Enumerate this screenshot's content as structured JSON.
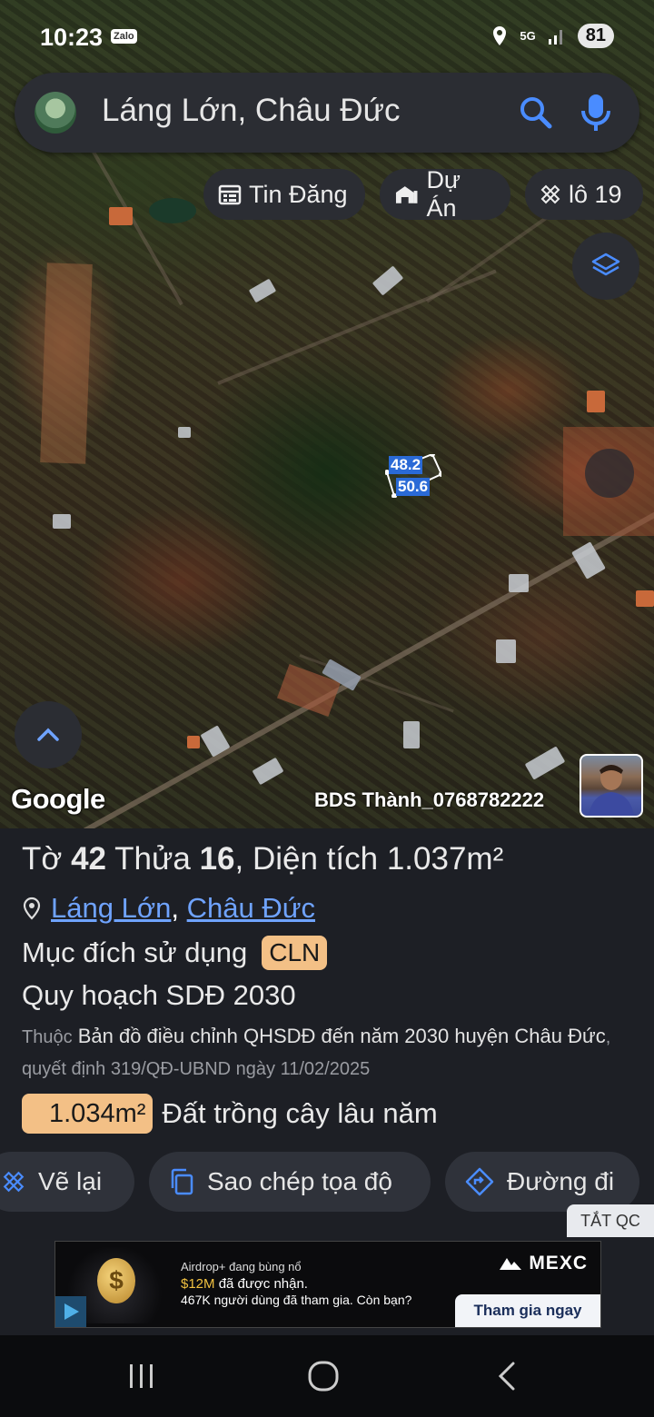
{
  "status_bar": {
    "time": "10:23",
    "app_badge": "Zalo",
    "network": "5G",
    "battery": "81"
  },
  "search": {
    "query": "Láng Lớn, Châu Đức"
  },
  "chips": {
    "listings": "Tin Đăng",
    "projects": "Dự Án",
    "lot": "lô 19"
  },
  "map": {
    "parcel_edge_1": "48.2",
    "parcel_edge_2": "50.6",
    "attribution": "Google",
    "watermark": "BDS Thành_0768782222"
  },
  "parcel": {
    "title_sheet_label": "Tờ",
    "sheet": "42",
    "title_plot_label": "Thửa",
    "plot": "16",
    "title_area_label": ", Diện tích",
    "area": "1.037m²",
    "commune": "Láng Lớn",
    "separator": ",",
    "district": "Châu Đức",
    "purpose_label": "Mục đích sử dụng",
    "purpose_code": "CLN",
    "plan_title": "Quy hoạch SDĐ 2030",
    "desc_prefix": "Thuộc",
    "desc_map": "Bản đồ điều chỉnh QHSDĐ đến năm 2030 huyện Châu Đức",
    "desc_decision": ", quyết định 319/QĐ-UBND ngày 11/02/2025",
    "landuse_area": "1.034m²",
    "landuse_type": "Đất trồng cây lâu năm"
  },
  "actions": {
    "redraw": "Vẽ lại",
    "copy_coords": "Sao chép tọa độ",
    "directions": "Đường đi",
    "hide_ads": "TẮT QC"
  },
  "ad": {
    "line1": "Airdrop+ đang bùng nổ",
    "line2_amount": "$12M",
    "line2_rest": " đã được nhận.",
    "line3": "467K người dùng đã tham gia. Còn bạn?",
    "brand": "MEXC",
    "cta": "Tham gia ngay",
    "coin_symbol": "$"
  },
  "colors": {
    "accent_blue": "#4a8cff",
    "badge_orange": "#f3c086",
    "panel_bg": "#1d1f25"
  }
}
